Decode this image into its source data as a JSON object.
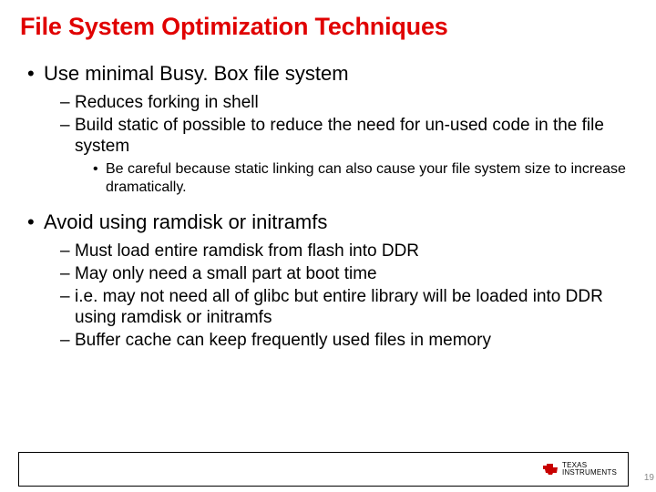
{
  "title": "File System Optimization Techniques",
  "bullets": [
    {
      "text": "Use minimal Busy. Box file system",
      "children": [
        {
          "text": "Reduces forking in shell"
        },
        {
          "text": "Build static of possible to reduce the need for un-used code in the file system",
          "children": [
            {
              "text": "Be careful because static linking can also cause your file system size to increase dramatically."
            }
          ]
        }
      ]
    },
    {
      "text": "Avoid using ramdisk or initramfs",
      "children": [
        {
          "text": "Must load entire ramdisk from flash into DDR"
        },
        {
          "text": "May only need a small part at boot time"
        },
        {
          "text": "i.e. may not need all of glibc but entire library will be loaded into DDR using ramdisk or initramfs"
        },
        {
          "text": "Buffer cache can keep frequently used files in memory"
        }
      ]
    }
  ],
  "footer": {
    "logo_line1": "TEXAS",
    "logo_line2": "INSTRUMENTS"
  },
  "page_number": "19"
}
